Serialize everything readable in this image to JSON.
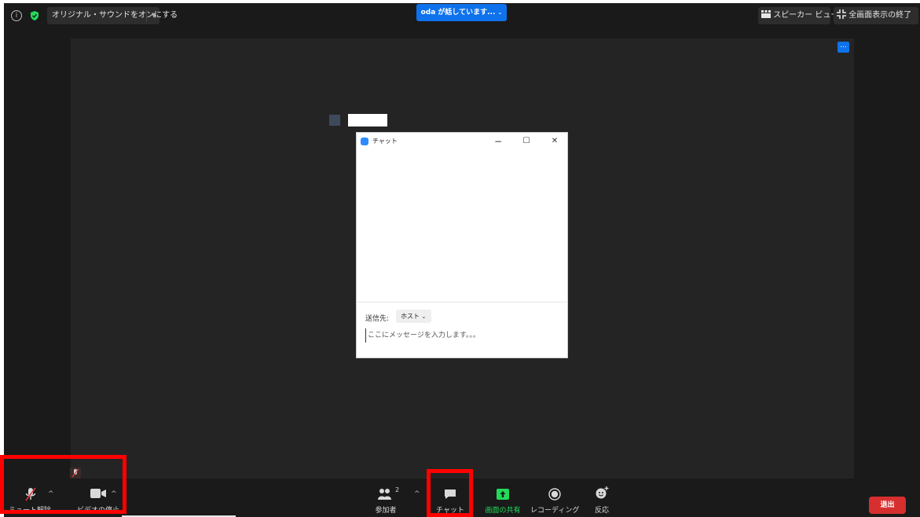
{
  "topbar": {
    "info_icon": "info-icon",
    "security_icon": "shield-icon",
    "security_color": "#23d959",
    "original_sound_label": "オリジナル・サウンドをオンにする",
    "speaking_indicator": "oda が話しています...",
    "speaker_view_label": "スピーカー ビュー",
    "exit_fullscreen_label": "全画面表示の終了"
  },
  "video": {
    "more_button": "..."
  },
  "chat_window": {
    "title": "チャット",
    "minimize": "−",
    "maximize": "☐",
    "close": "✕",
    "to_label": "送信先:",
    "to_value": "ホスト",
    "message_placeholder": "ここにメッセージを入力します。。。"
  },
  "toolbar": {
    "mute_label": "ミュート解除",
    "video_label": "ビデオの停止",
    "participants_label": "参加者",
    "participants_count": "2",
    "chat_label": "チャット",
    "share_label": "画面の共有",
    "record_label": "レコーディング",
    "reaction_label": "反応",
    "leave_label": "退出",
    "share_color": "#23d959",
    "leave_color": "#d72f2f",
    "accent": "#0e72ed"
  },
  "highlight_color": "#ff0000"
}
